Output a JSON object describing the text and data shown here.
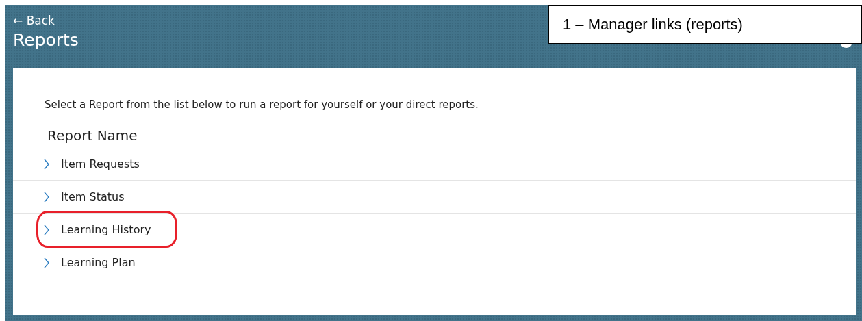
{
  "header": {
    "back_link": "← Back",
    "title": "Reports"
  },
  "callout": {
    "text": "1 – Manager links (reports)"
  },
  "card": {
    "intro": "Select a Report from the list below to run a report for yourself or your direct reports.",
    "heading": "Report Name",
    "reports": [
      {
        "label": "Item Requests",
        "highlighted": false
      },
      {
        "label": "Item Status",
        "highlighted": false
      },
      {
        "label": "Learning History",
        "highlighted": true
      },
      {
        "label": "Learning Plan",
        "highlighted": false
      }
    ]
  }
}
